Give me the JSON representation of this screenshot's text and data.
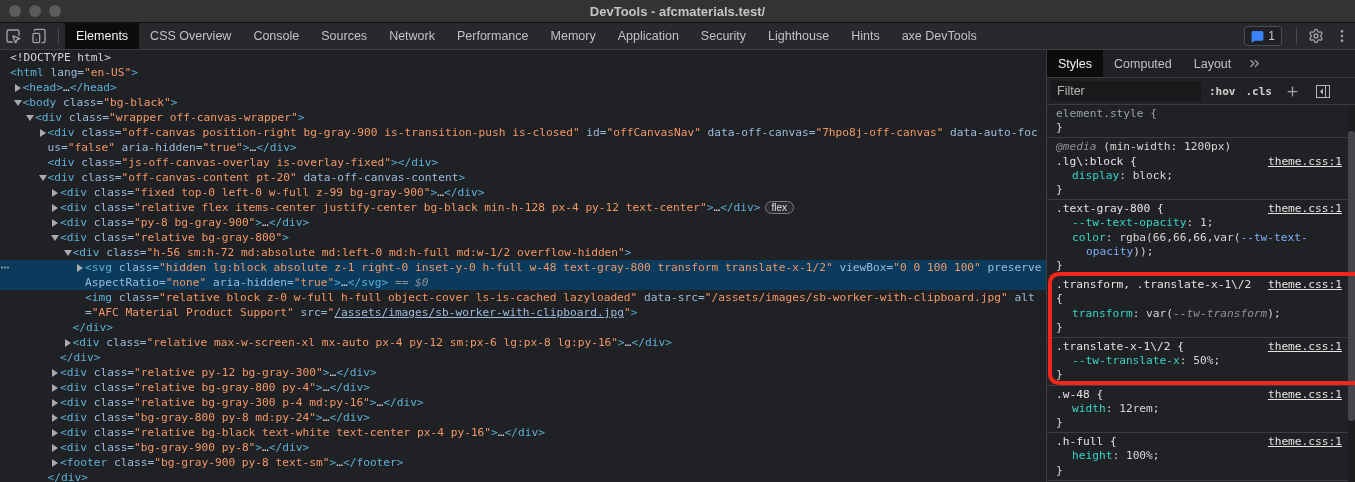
{
  "window": {
    "title": "DevTools - afcmaterials.test/"
  },
  "toolbar": {
    "tabs": [
      {
        "label": "Elements",
        "selected": true
      },
      {
        "label": "CSS Overview",
        "selected": false
      },
      {
        "label": "Console",
        "selected": false
      },
      {
        "label": "Sources",
        "selected": false
      },
      {
        "label": "Network",
        "selected": false
      },
      {
        "label": "Performance",
        "selected": false
      },
      {
        "label": "Memory",
        "selected": false
      },
      {
        "label": "Application",
        "selected": false
      },
      {
        "label": "Security",
        "selected": false
      },
      {
        "label": "Lighthouse",
        "selected": false
      },
      {
        "label": "Hints",
        "selected": false
      },
      {
        "label": "axe DevTools",
        "selected": false
      }
    ],
    "issues_count": "1"
  },
  "dom_tree": [
    {
      "selected": false,
      "tokens": [
        {
          "kind": "plain",
          "text": "<!DOCTYPE html>"
        }
      ]
    },
    {
      "selected": false,
      "tokens": [
        {
          "kind": "tag",
          "text": "<html"
        },
        {
          "kind": "attr",
          "text": " lang="
        },
        {
          "kind": "value",
          "text": "\"en-US\""
        },
        {
          "kind": "tag",
          "text": ">"
        }
      ],
      "children": [
        {
          "expanded": false,
          "selected": false,
          "tokens": [
            {
              "kind": "tag",
              "text": "<head>"
            },
            {
              "kind": "plain",
              "text": "…"
            },
            {
              "kind": "tag",
              "text": "</head>"
            }
          ]
        },
        {
          "expanded": true,
          "selected": false,
          "tokens": [
            {
              "kind": "tag",
              "text": "<body"
            },
            {
              "kind": "attr",
              "text": " class="
            },
            {
              "kind": "value",
              "text": "\"bg-black\""
            },
            {
              "kind": "tag",
              "text": ">"
            }
          ],
          "children": [
            {
              "expanded": true,
              "selected": false,
              "tokens": [
                {
                  "kind": "tag",
                  "text": "<div"
                },
                {
                  "kind": "attr",
                  "text": " class="
                },
                {
                  "kind": "value",
                  "text": "\"wrapper off-canvas-wrapper\""
                },
                {
                  "kind": "tag",
                  "text": ">"
                }
              ],
              "children": [
                {
                  "expanded": false,
                  "selected": false,
                  "tokens": [
                    {
                      "kind": "tag",
                      "text": "<div"
                    },
                    {
                      "kind": "attr",
                      "text": " class="
                    },
                    {
                      "kind": "value",
                      "text": "\"off-canvas position-right bg-gray-900 is-transition-push is-closed\""
                    },
                    {
                      "kind": "attr",
                      "text": " id="
                    },
                    {
                      "kind": "value",
                      "text": "\"offCanvasNav\""
                    },
                    {
                      "kind": "attr",
                      "text": " data-off-canvas="
                    },
                    {
                      "kind": "value",
                      "text": "\"7hpo8j-off-canvas\""
                    },
                    {
                      "kind": "attr",
                      "text": " data-auto-focus="
                    },
                    {
                      "kind": "value",
                      "text": "\"false\""
                    },
                    {
                      "kind": "attr",
                      "text": " aria-hidden="
                    },
                    {
                      "kind": "value",
                      "text": "\"true\""
                    },
                    {
                      "kind": "tag",
                      "text": ">"
                    },
                    {
                      "kind": "plain",
                      "text": "…"
                    },
                    {
                      "kind": "tag",
                      "text": "</div>"
                    }
                  ]
                },
                {
                  "selected": false,
                  "tokens": [
                    {
                      "kind": "tag",
                      "text": "<div"
                    },
                    {
                      "kind": "attr",
                      "text": " class="
                    },
                    {
                      "kind": "value",
                      "text": "\"js-off-canvas-overlay is-overlay-fixed\""
                    },
                    {
                      "kind": "tag",
                      "text": "></div>"
                    }
                  ]
                },
                {
                  "expanded": true,
                  "selected": false,
                  "tokens": [
                    {
                      "kind": "tag",
                      "text": "<div"
                    },
                    {
                      "kind": "attr",
                      "text": " class="
                    },
                    {
                      "kind": "value",
                      "text": "\"off-canvas-content pt-20\""
                    },
                    {
                      "kind": "attr",
                      "text": " data-off-canvas-content"
                    },
                    {
                      "kind": "tag",
                      "text": ">"
                    }
                  ],
                  "closing": [
                    {
                      "kind": "tag",
                      "text": "</div>"
                    }
                  ],
                  "children": [
                    {
                      "expanded": false,
                      "selected": false,
                      "tokens": [
                        {
                          "kind": "tag",
                          "text": "<div"
                        },
                        {
                          "kind": "attr",
                          "text": " class="
                        },
                        {
                          "kind": "value",
                          "text": "\"fixed top-0 left-0 w-full z-99 bg-gray-900\""
                        },
                        {
                          "kind": "tag",
                          "text": ">"
                        },
                        {
                          "kind": "plain",
                          "text": "…"
                        },
                        {
                          "kind": "tag",
                          "text": "</div>"
                        }
                      ]
                    },
                    {
                      "expanded": false,
                      "selected": false,
                      "badge": "flex",
                      "tokens": [
                        {
                          "kind": "tag",
                          "text": "<div"
                        },
                        {
                          "kind": "attr",
                          "text": " class="
                        },
                        {
                          "kind": "value",
                          "text": "\"relative flex items-center justify-center bg-black min-h-128 px-4 py-12 text-center\""
                        },
                        {
                          "kind": "tag",
                          "text": ">"
                        },
                        {
                          "kind": "plain",
                          "text": "…"
                        },
                        {
                          "kind": "tag",
                          "text": "</div>"
                        }
                      ]
                    },
                    {
                      "expanded": false,
                      "selected": false,
                      "tokens": [
                        {
                          "kind": "tag",
                          "text": "<div"
                        },
                        {
                          "kind": "attr",
                          "text": " class="
                        },
                        {
                          "kind": "value",
                          "text": "\"py-8 bg-gray-900\""
                        },
                        {
                          "kind": "tag",
                          "text": ">"
                        },
                        {
                          "kind": "plain",
                          "text": "…"
                        },
                        {
                          "kind": "tag",
                          "text": "</div>"
                        }
                      ]
                    },
                    {
                      "expanded": true,
                      "selected": false,
                      "tokens": [
                        {
                          "kind": "tag",
                          "text": "<div"
                        },
                        {
                          "kind": "attr",
                          "text": " class="
                        },
                        {
                          "kind": "value",
                          "text": "\"relative bg-gray-800\""
                        },
                        {
                          "kind": "tag",
                          "text": ">"
                        }
                      ],
                      "closing": [
                        {
                          "kind": "tag",
                          "text": "</div>"
                        }
                      ],
                      "children": [
                        {
                          "expanded": true,
                          "selected": false,
                          "tokens": [
                            {
                              "kind": "tag",
                              "text": "<div"
                            },
                            {
                              "kind": "attr",
                              "text": " class="
                            },
                            {
                              "kind": "value",
                              "text": "\"h-56 sm:h-72 md:absolute md:left-0 md:h-full md:w-1/2 overflow-hidden\""
                            },
                            {
                              "kind": "tag",
                              "text": ">"
                            }
                          ],
                          "closing": [
                            {
                              "kind": "tag",
                              "text": "</div>"
                            }
                          ],
                          "children": [
                            {
                              "expanded": false,
                              "selected": true,
                              "tokens": [
                                {
                                  "kind": "tag",
                                  "text": "<svg"
                                },
                                {
                                  "kind": "attr",
                                  "text": " class="
                                },
                                {
                                  "kind": "value",
                                  "text": "\"hidden lg:block absolute z-1 right-0 inset-y-0 h-full w-48 text-gray-800 transform translate-x-1/2\""
                                },
                                {
                                  "kind": "attr",
                                  "text": " viewBox="
                                },
                                {
                                  "kind": "value",
                                  "text": "\"0 0 100 100\""
                                },
                                {
                                  "kind": "attr",
                                  "text": " preserveAspectRatio="
                                },
                                {
                                  "kind": "value",
                                  "text": "\"none\""
                                },
                                {
                                  "kind": "attr",
                                  "text": " aria-hidden="
                                },
                                {
                                  "kind": "value",
                                  "text": "\"true\""
                                },
                                {
                                  "kind": "tag",
                                  "text": ">"
                                },
                                {
                                  "kind": "plain",
                                  "text": "…"
                                },
                                {
                                  "kind": "tag",
                                  "text": "</svg>"
                                },
                                {
                                  "kind": "dim",
                                  "text": " == $0"
                                }
                              ]
                            },
                            {
                              "selected": false,
                              "tokens": [
                                {
                                  "kind": "tag",
                                  "text": "<img"
                                },
                                {
                                  "kind": "attr",
                                  "text": " class="
                                },
                                {
                                  "kind": "value",
                                  "text": "\"relative block z-0 w-full h-full object-cover ls-is-cached lazyloaded\""
                                },
                                {
                                  "kind": "attr",
                                  "text": " data-src="
                                },
                                {
                                  "kind": "value",
                                  "text": "\"/assets/images/sb-worker-with-clipboard.jpg\""
                                },
                                {
                                  "kind": "attr",
                                  "text": " alt="
                                },
                                {
                                  "kind": "value",
                                  "text": "\"AFC Material Product Support\""
                                },
                                {
                                  "kind": "attr",
                                  "text": " src="
                                },
                                {
                                  "kind": "value",
                                  "text": "\""
                                },
                                {
                                  "kind": "link",
                                  "text": "/assets/images/sb-worker-with-clipboard.jpg"
                                },
                                {
                                  "kind": "value",
                                  "text": "\""
                                },
                                {
                                  "kind": "tag",
                                  "text": ">"
                                }
                              ]
                            }
                          ]
                        },
                        {
                          "expanded": false,
                          "selected": false,
                          "tokens": [
                            {
                              "kind": "tag",
                              "text": "<div"
                            },
                            {
                              "kind": "attr",
                              "text": " class="
                            },
                            {
                              "kind": "value",
                              "text": "\"relative max-w-screen-xl mx-auto px-4 py-12 sm:px-6 lg:px-8 lg:py-16\""
                            },
                            {
                              "kind": "tag",
                              "text": ">"
                            },
                            {
                              "kind": "plain",
                              "text": "…"
                            },
                            {
                              "kind": "tag",
                              "text": "</div>"
                            }
                          ]
                        }
                      ]
                    },
                    {
                      "expanded": false,
                      "selected": false,
                      "tokens": [
                        {
                          "kind": "tag",
                          "text": "<div"
                        },
                        {
                          "kind": "attr",
                          "text": " class="
                        },
                        {
                          "kind": "value",
                          "text": "\"relative py-12 bg-gray-300\""
                        },
                        {
                          "kind": "tag",
                          "text": ">"
                        },
                        {
                          "kind": "plain",
                          "text": "…"
                        },
                        {
                          "kind": "tag",
                          "text": "</div>"
                        }
                      ]
                    },
                    {
                      "expanded": false,
                      "selected": false,
                      "tokens": [
                        {
                          "kind": "tag",
                          "text": "<div"
                        },
                        {
                          "kind": "attr",
                          "text": " class="
                        },
                        {
                          "kind": "value",
                          "text": "\"relative bg-gray-800 py-4\""
                        },
                        {
                          "kind": "tag",
                          "text": ">"
                        },
                        {
                          "kind": "plain",
                          "text": "…"
                        },
                        {
                          "kind": "tag",
                          "text": "</div>"
                        }
                      ]
                    },
                    {
                      "expanded": false,
                      "selected": false,
                      "tokens": [
                        {
                          "kind": "tag",
                          "text": "<div"
                        },
                        {
                          "kind": "attr",
                          "text": " class="
                        },
                        {
                          "kind": "value",
                          "text": "\"relative bg-gray-300 p-4 md:py-16\""
                        },
                        {
                          "kind": "tag",
                          "text": ">"
                        },
                        {
                          "kind": "plain",
                          "text": "…"
                        },
                        {
                          "kind": "tag",
                          "text": "</div>"
                        }
                      ]
                    },
                    {
                      "expanded": false,
                      "selected": false,
                      "tokens": [
                        {
                          "kind": "tag",
                          "text": "<div"
                        },
                        {
                          "kind": "attr",
                          "text": " class="
                        },
                        {
                          "kind": "value",
                          "text": "\"bg-gray-800 py-8 md:py-24\""
                        },
                        {
                          "kind": "tag",
                          "text": ">"
                        },
                        {
                          "kind": "plain",
                          "text": "…"
                        },
                        {
                          "kind": "tag",
                          "text": "</div>"
                        }
                      ]
                    },
                    {
                      "expanded": false,
                      "selected": false,
                      "tokens": [
                        {
                          "kind": "tag",
                          "text": "<div"
                        },
                        {
                          "kind": "attr",
                          "text": " class="
                        },
                        {
                          "kind": "value",
                          "text": "\"relative bg-black text-white text-center px-4 py-16\""
                        },
                        {
                          "kind": "tag",
                          "text": ">"
                        },
                        {
                          "kind": "plain",
                          "text": "…"
                        },
                        {
                          "kind": "tag",
                          "text": "</div>"
                        }
                      ]
                    },
                    {
                      "expanded": false,
                      "selected": false,
                      "tokens": [
                        {
                          "kind": "tag",
                          "text": "<div"
                        },
                        {
                          "kind": "attr",
                          "text": " class="
                        },
                        {
                          "kind": "value",
                          "text": "\"bg-gray-900 py-8\""
                        },
                        {
                          "kind": "tag",
                          "text": ">"
                        },
                        {
                          "kind": "plain",
                          "text": "…"
                        },
                        {
                          "kind": "tag",
                          "text": "</div>"
                        }
                      ]
                    },
                    {
                      "expanded": false,
                      "selected": false,
                      "tokens": [
                        {
                          "kind": "tag",
                          "text": "<footer"
                        },
                        {
                          "kind": "attr",
                          "text": " class="
                        },
                        {
                          "kind": "value",
                          "text": "\"bg-gray-900 py-8 text-sm\""
                        },
                        {
                          "kind": "tag",
                          "text": ">"
                        },
                        {
                          "kind": "plain",
                          "text": "…"
                        },
                        {
                          "kind": "tag",
                          "text": "</footer>"
                        }
                      ]
                    }
                  ]
                }
              ]
            }
          ]
        }
      ]
    }
  ],
  "styles_pane": {
    "tabs": [
      {
        "label": "Styles",
        "selected": true
      },
      {
        "label": "Computed",
        "selected": false
      },
      {
        "label": "Layout",
        "selected": false
      }
    ],
    "filter": {
      "placeholder": "Filter"
    },
    "hov": ":hov",
    "cls": ".cls",
    "rules": [
      {
        "selector_lines": [
          "element.style {"
        ],
        "close": "}"
      },
      {
        "media": [
          {
            "kind": "dim",
            "text": "@media"
          },
          {
            "kind": "plain",
            "text": " (min-width: 1200px)"
          }
        ],
        "selector_lines": [
          ".lg\\:block {"
        ],
        "source": "theme.css:1",
        "declarations": [
          [
            {
              "kind": "prop",
              "text": "display"
            },
            {
              "kind": "plain",
              "text": ": block;"
            }
          ]
        ],
        "close": "}"
      },
      {
        "selector_lines": [
          ".text-gray-800 {"
        ],
        "source": "theme.css:1",
        "declarations": [
          [
            {
              "kind": "prop",
              "text": "--tw-text-opacity"
            },
            {
              "kind": "plain",
              "text": ": 1;"
            }
          ],
          [
            {
              "kind": "prop",
              "text": "color"
            },
            {
              "kind": "plain",
              "text": ": rgba(66,66,66,var("
            },
            {
              "kind": "var",
              "text": "--tw-text-opacity"
            },
            {
              "kind": "plain",
              "text": "));"
            }
          ]
        ],
        "close": "}"
      },
      {
        "selector_lines": [
          ".transform, .translate-x-1\\/2",
          "{"
        ],
        "source": "theme.css:1",
        "declarations": [
          [
            {
              "kind": "prop",
              "text": "transform"
            },
            {
              "kind": "plain",
              "text": ": var("
            },
            {
              "kind": "dim",
              "text": "--tw-transform"
            },
            {
              "kind": "plain",
              "text": ");"
            }
          ]
        ],
        "close": "}"
      },
      {
        "selector_lines": [
          ".translate-x-1\\/2 {"
        ],
        "source": "theme.css:1",
        "declarations": [
          [
            {
              "kind": "prop",
              "text": "--tw-translate-x"
            },
            {
              "kind": "plain",
              "text": ": 50%;"
            }
          ]
        ],
        "close": "}"
      },
      {
        "selector_lines": [
          ".w-48 {"
        ],
        "source": "theme.css:1",
        "declarations": [
          [
            {
              "kind": "prop",
              "text": "width"
            },
            {
              "kind": "plain",
              "text": ": 12rem;"
            }
          ]
        ],
        "close": "}"
      },
      {
        "selector_lines": [
          ".h-full {"
        ],
        "source": "theme.css:1",
        "declarations": [
          [
            {
              "kind": "prop",
              "text": "height"
            },
            {
              "kind": "plain",
              "text": ": 100%;"
            }
          ]
        ],
        "close": "}"
      }
    ]
  }
}
